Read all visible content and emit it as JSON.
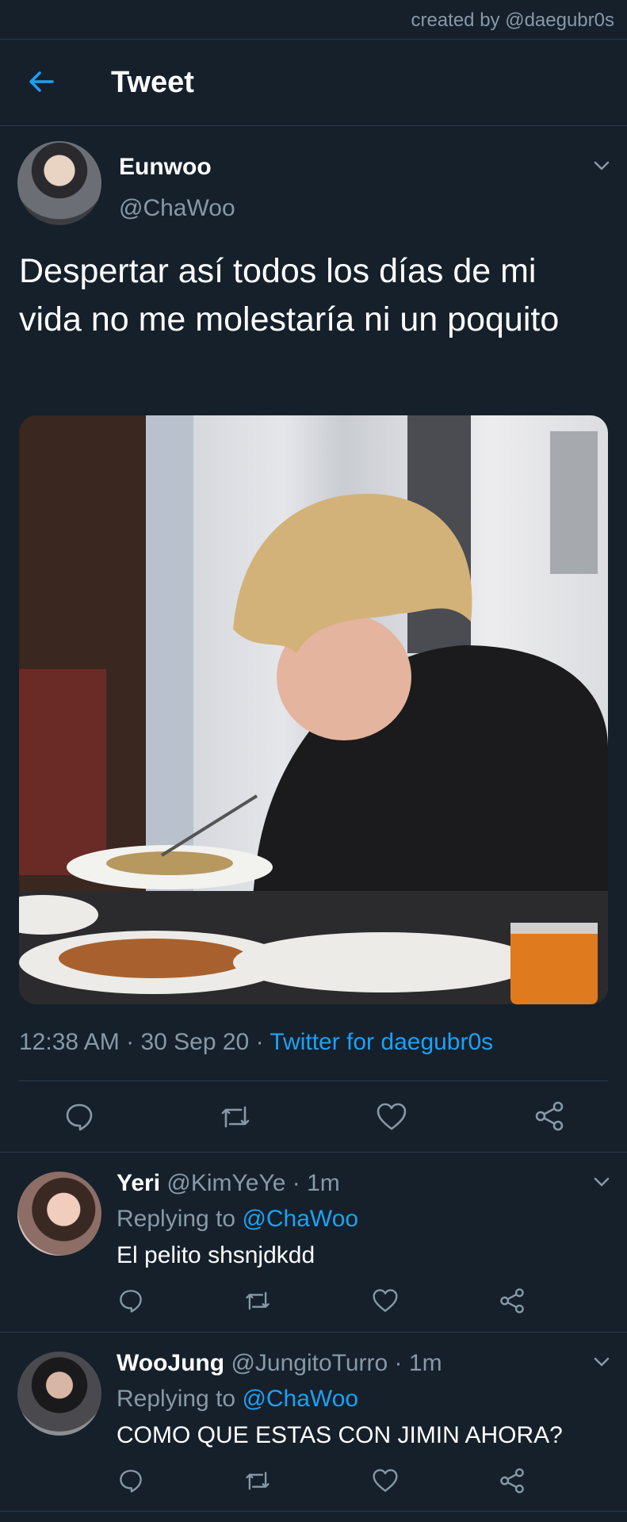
{
  "credit": "created by @daegubr0s",
  "header": {
    "title": "Tweet",
    "back_icon": "arrow-left-icon"
  },
  "tweet": {
    "author_name": "Eunwoo",
    "author_handle": "@ChaWoo",
    "text": "Despertar así todos los días de mi vida no me molestaría ni un poquito",
    "time": "12:38 AM",
    "date": "30 Sep 20",
    "separator": " · ",
    "source": "Twitter for daegubr0s",
    "actions": [
      "reply-icon",
      "retweet-icon",
      "like-icon",
      "share-icon"
    ]
  },
  "replies": [
    {
      "name": "Yeri",
      "handle": "@KimYeYe",
      "time": "1m",
      "replying_label": "Replying to",
      "replying_to": "@ChaWoo",
      "text": "El pelito shsnjdkdd"
    },
    {
      "name": "WooJung",
      "handle": "@JungitoTurro",
      "time": "1m",
      "replying_label": "Replying to",
      "replying_to": "@ChaWoo",
      "text": "COMO QUE ESTAS CON JIMIN AHORA?"
    }
  ],
  "colors": {
    "background": "#15202b",
    "accent": "#1da1f2",
    "secondary_text": "#8899a6",
    "divider": "#2b3a48"
  }
}
